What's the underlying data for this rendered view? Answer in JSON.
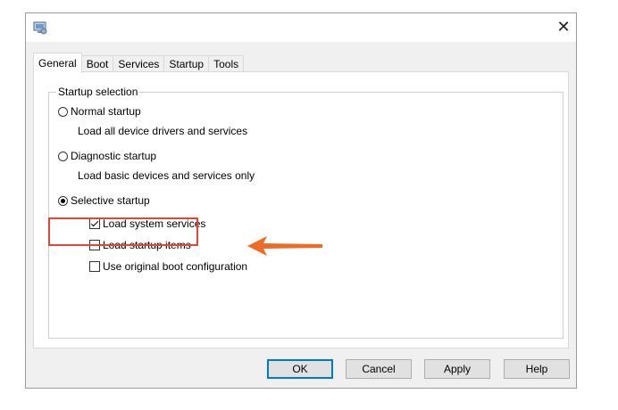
{
  "window": {
    "close_icon": "close-icon",
    "app_icon": "msconfig-icon"
  },
  "tabs": [
    {
      "label": "General",
      "active": true
    },
    {
      "label": "Boot",
      "active": false
    },
    {
      "label": "Services",
      "active": false
    },
    {
      "label": "Startup",
      "active": false
    },
    {
      "label": "Tools",
      "active": false
    }
  ],
  "startup_selection": {
    "group_label": "Startup selection",
    "normal": {
      "label": "Normal startup",
      "description": "Load all device drivers and services",
      "selected": false
    },
    "diagnostic": {
      "label": "Diagnostic startup",
      "description": "Load basic devices and services only",
      "selected": false
    },
    "selective": {
      "label": "Selective startup",
      "selected": true
    },
    "options": {
      "load_system_services": {
        "label": "Load system services",
        "checked": true
      },
      "load_startup_items": {
        "label": "Load startup items",
        "checked": false
      },
      "use_original_boot": {
        "label": "Use original boot configuration",
        "checked": false
      }
    }
  },
  "annotation": {
    "color": "#e2453a",
    "arrow_color": "#ef6a26"
  },
  "buttons": {
    "ok": "OK",
    "cancel": "Cancel",
    "apply": "Apply",
    "help": "Help"
  }
}
